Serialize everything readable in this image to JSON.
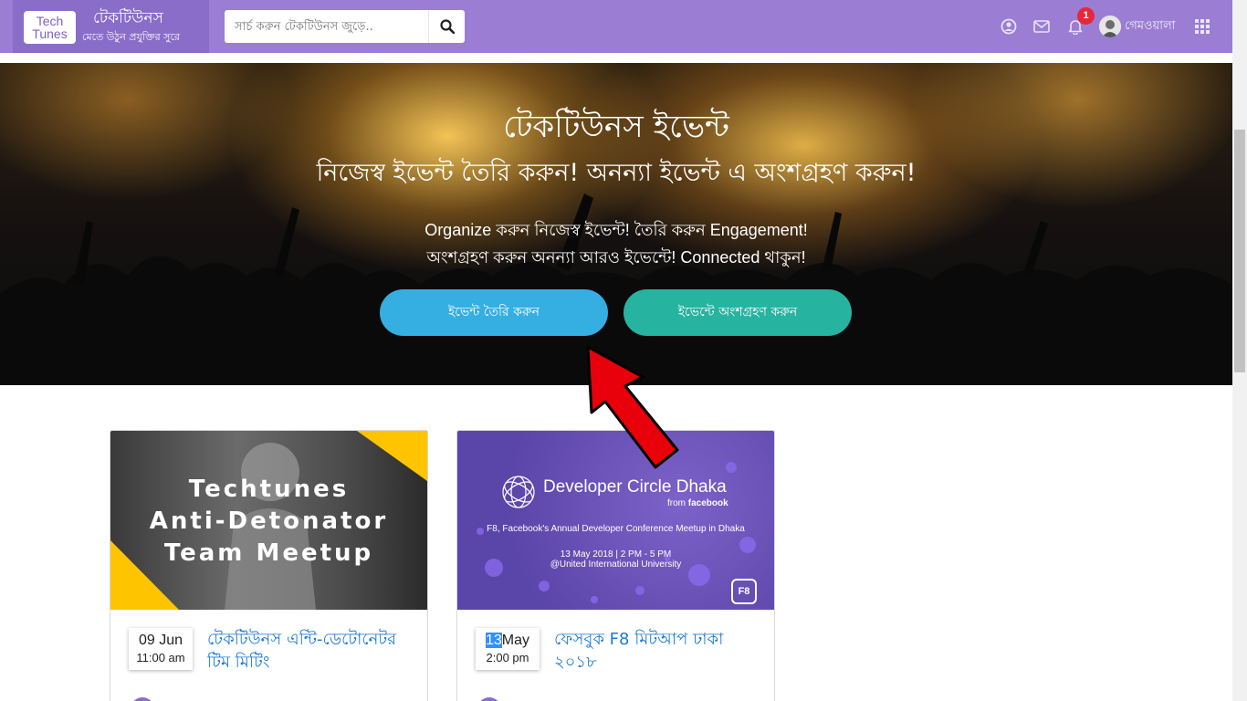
{
  "header": {
    "logo_line1": "Tech",
    "logo_line2": "Tunes",
    "brand_name": "টেকটিউনস",
    "brand_tagline": "মেতে উঠুন প্রযুক্তির সুরে",
    "search_placeholder": "সার্চ করুন টেকটিউনস জুড়ে..",
    "notification_count": "1",
    "username": "গেমওয়ালা",
    "icons": [
      "user-icon",
      "mail-icon",
      "bell-icon",
      "apps-grid-icon",
      "search-icon"
    ]
  },
  "hero": {
    "title": "টেকটিউনস ইভেন্ট",
    "subtitle": "নিজেস্ব ইভেন্ট তৈরি করুন! অনন্যা ইভেন্ট এ অংশগ্রহণ করুন!",
    "description_line1": "Organize করুন নিজেস্ব ইভেন্ট! তৈরি করুন Engagement!",
    "description_line2": "অংশগ্রহণ করুন অনন্যা আরও ইভেন্টে! Connected থাকুন!",
    "create_button": "ইভেন্ট তৈরি করুন",
    "join_button": "ইভেন্টে অংশগ্রহণ করুন"
  },
  "events": [
    {
      "image_lines": [
        "Techtunes",
        "Anti-Detonator",
        "Team Meetup"
      ],
      "date": "09 Jun",
      "time": "11:00 am",
      "title": "টেকটিউনস এন্টি-ডেটোনেটর টিম মিটিং"
    },
    {
      "image_title": "Developer Circle Dhaka",
      "image_from": "from",
      "image_brand": "facebook",
      "image_line1": "F8, Facebook's Annual Developer Conference Meetup in Dhaka",
      "image_line2": "13 May 2018  |  2 PM - 5 PM",
      "image_line3": "@United International University",
      "image_badge": "F8",
      "date_day": "13",
      "date_month": "May",
      "time": "2:00 pm",
      "title": "ফেসবুক F8 মিটআপ ঢাকা ২০১৮"
    }
  ],
  "colors": {
    "header_bg": "#9b7ed3",
    "create_button": "#35aee2",
    "join_button": "#26b39f",
    "link": "#1b7ad4",
    "arrow": "#e8000b"
  }
}
